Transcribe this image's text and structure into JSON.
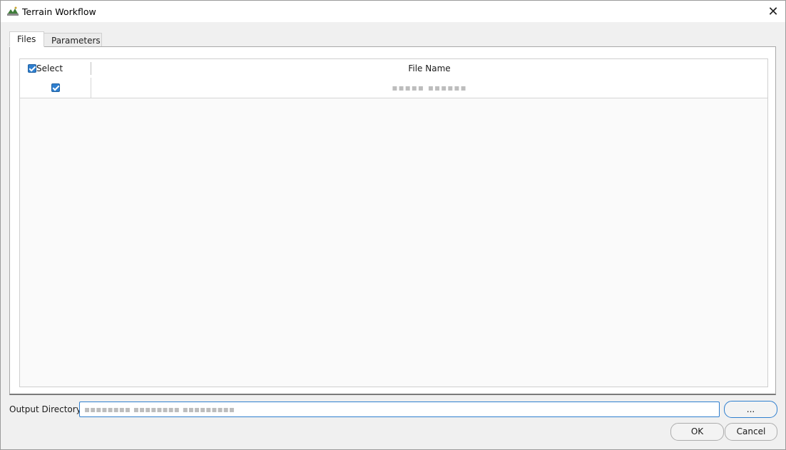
{
  "window": {
    "title": "Terrain Workflow",
    "close_glyph": "✕",
    "icon": "terrain-app-icon"
  },
  "tabs": [
    {
      "label": "Files",
      "active": true
    },
    {
      "label": "Parameters",
      "active": false
    }
  ],
  "grid": {
    "columns": [
      "Select",
      "File Name"
    ],
    "rows": [
      {
        "selected": true,
        "file_name": "▪▪▪▪▪ ▪▪▪▪▪▪"
      }
    ],
    "header_select_checked": true
  },
  "output": {
    "label": "Output Directory:",
    "value": "▪▪▪▪▪▪▪▪ ▪▪▪▪▪▪▪▪ ▪▪▪▪▪▪▪▪▪",
    "browse_label": "..."
  },
  "buttons": {
    "ok": "OK",
    "cancel": "Cancel"
  },
  "colors": {
    "accent": "#2f7fcf",
    "background": "#f0f0f0"
  }
}
